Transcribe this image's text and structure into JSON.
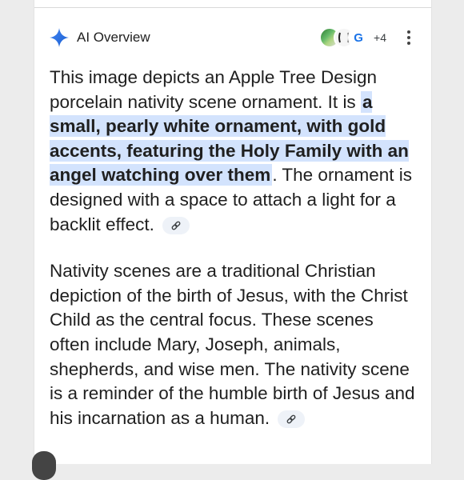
{
  "header": {
    "title": "AI Overview",
    "source_count": "+4",
    "sources": [
      "source-thumbnail-1",
      "source-thumbnail-2",
      "google-logo-icon"
    ]
  },
  "paragraphs": [
    {
      "before": "This image depicts an Apple Tree Design porcelain nativity scene ornament. It is ",
      "highlight": "a small, pearly white ornament, with gold accents, featuring the Holy Family with an angel watching over them",
      "after": ". The ornament is designed with a space to attach a light for a backlit effect."
    },
    {
      "text": "Nativity scenes are a traditional Christian depiction of the birth of Jesus, with the Christ Child as the central focus. These scenes often include Mary, Joseph, animals, shepherds, and wise men. The nativity scene is a reminder of the humble birth of Jesus and his incarnation as a human."
    }
  ],
  "colors": {
    "sparkle": "#1a73e8",
    "highlight": "#d3e3fd",
    "chip": "#eef2f8"
  }
}
